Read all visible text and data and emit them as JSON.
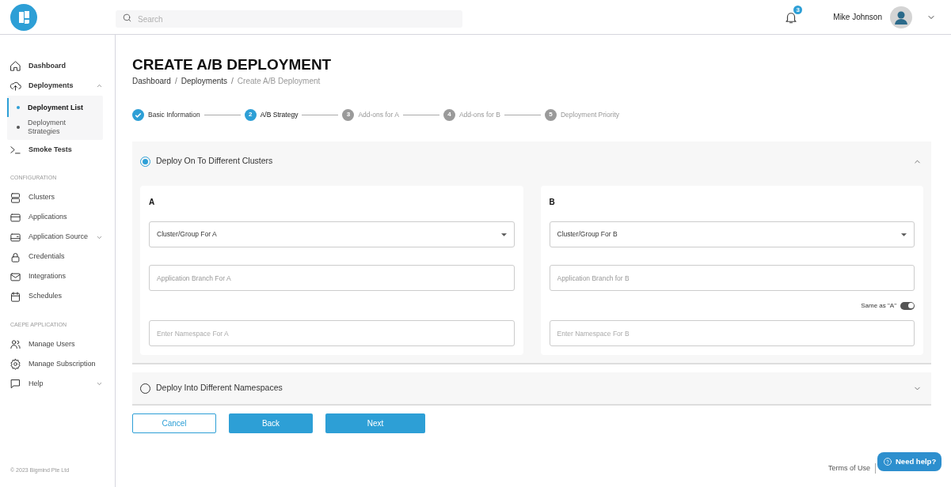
{
  "header": {
    "search": {
      "placeholder": "Search"
    },
    "notifications": {
      "count": "3"
    },
    "user": {
      "name": "Mike Johnson"
    }
  },
  "sidebar": {
    "sections": [
      {
        "items": [
          {
            "label": "Dashboard"
          },
          {
            "label": "Deployments",
            "expanded": true,
            "children": [
              {
                "label": "Deployment List",
                "selected": true
              },
              {
                "label": "Deployment Strategies",
                "selected": false
              }
            ]
          },
          {
            "label": "Smoke Tests"
          }
        ]
      },
      {
        "heading": "CONFIGURATION",
        "items": [
          {
            "label": "Clusters"
          },
          {
            "label": "Applications"
          },
          {
            "label": "Application Source",
            "expanded": false
          },
          {
            "label": "Credentials"
          },
          {
            "label": "Integrations"
          },
          {
            "label": "Schedules"
          }
        ]
      },
      {
        "heading": "CAEPE APPLICATION",
        "items": [
          {
            "label": "Manage Users"
          },
          {
            "label": "Manage Subscription"
          },
          {
            "label": "Help",
            "expanded": false
          }
        ]
      }
    ],
    "copyright": "© 2023 Bigmind Pte Ltd"
  },
  "page": {
    "title": "CREATE A/B DEPLOYMENT",
    "separator": "/",
    "breadcrumb": [
      {
        "label": "Dashboard",
        "current": false
      },
      {
        "label": "Deployments",
        "current": false
      },
      {
        "label": "Create A/B Deployment",
        "current": true
      }
    ]
  },
  "steps": [
    {
      "label": "Basic Information",
      "completed": true,
      "selected": false
    },
    {
      "number": "2",
      "label": "A/B Strategy",
      "completed": false,
      "selected": true
    },
    {
      "number": "3",
      "label": "Add-ons for A",
      "completed": false,
      "selected": false
    },
    {
      "number": "4",
      "label": "Add-ons for B",
      "completed": false,
      "selected": false
    },
    {
      "number": "5",
      "label": "Deployment Priority",
      "completed": false,
      "selected": false
    }
  ],
  "options": [
    {
      "label": "Deploy On To Different Clusters",
      "selected": true,
      "expanded": true,
      "panels": [
        {
          "heading": "A",
          "cluster": {
            "value": "Cluster/Group For A"
          },
          "branch": {
            "placeholder": "Application Branch For A"
          },
          "namespace": {
            "placeholder": "Enter Namespace For A"
          }
        },
        {
          "heading": "B",
          "cluster": {
            "value": "Cluster/Group For B"
          },
          "branch": {
            "placeholder": "Application Branch for B"
          },
          "same_as": {
            "label": "Same as \"A\"",
            "on": true
          },
          "namespace": {
            "placeholder": "Enter Namespace For B"
          }
        }
      ]
    },
    {
      "label": "Deploy Into Different Namespaces",
      "selected": false,
      "expanded": false
    }
  ],
  "buttons": [
    {
      "label": "Cancel",
      "kind": "outline"
    },
    {
      "label": "Back",
      "kind": "filled"
    },
    {
      "label": "Next",
      "kind": "filled"
    }
  ],
  "footer": {
    "links": [
      "Terms of Use"
    ]
  },
  "help_button": {
    "label": "Need help?"
  }
}
